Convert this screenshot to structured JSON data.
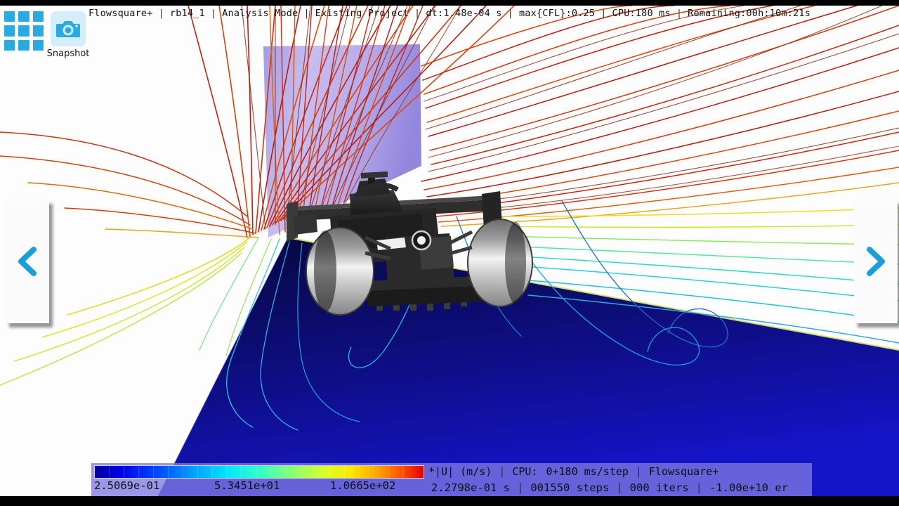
{
  "app": {
    "name": "Flowsquare+",
    "window_title": "Flowsquare+ Analysis Mode"
  },
  "topbar": {
    "segments": [
      "Flowsquare+",
      "rb14_1",
      "Analysis Mode",
      "Existing Project",
      "dt:1.48e-04 s",
      "max{CFL}:0.25",
      "CPU:180 ms",
      "Remaining:00h:10m:21s"
    ],
    "separator": "|"
  },
  "toolbar": {
    "grid_icon_name": "grid-apps-icon",
    "snapshot_label": "Snapshot",
    "snapshot_icon_name": "camera-icon"
  },
  "nav": {
    "prev_label": "<",
    "next_label": ">",
    "prev_icon": "chevron-left-icon",
    "next_icon": "chevron-right-icon"
  },
  "statusbar": {
    "colorbar": {
      "min_label": "2.5069e-01",
      "mid_label": "5.3451e+01",
      "max_label": "1.0665e+02",
      "colormap": "jet",
      "stops": [
        "#0000b0",
        "#0000ff",
        "#0080ff",
        "#00d4ff",
        "#40ffd0",
        "#a0ff60",
        "#ffff00",
        "#ffa000",
        "#ff4000",
        "#d00000"
      ]
    },
    "quantity_label": "*|U|  (m/s)",
    "time_value": "2.2798e-01 s",
    "cpu_label": "CPU:",
    "cpu_value": "0+180  ms/step",
    "steps_value": "001550 steps",
    "iters_value": "000 iters",
    "brand": "Flowsquare+",
    "residual": "-1.00e+10 er",
    "separator": "|"
  },
  "scene": {
    "description": "CFD streamline visualization around an F1 car rear view",
    "background_color": "#ffffff",
    "ground_color": "#0b0b6e",
    "ground_highlight_color": "#d8e86a",
    "inlet_plane_color": "#b4a8e8",
    "car_body_color": "#2b2b2b",
    "tyre_color": "#9a9a9a"
  },
  "chart_data": {
    "type": "heatmap",
    "title": "Velocity magnitude |U| colorbar",
    "colormap": "jet",
    "tick_labels": [
      "2.5069e-01",
      "5.3451e+01",
      "1.0665e+02"
    ],
    "tick_values": [
      0.25069,
      53.451,
      106.65
    ],
    "unit": "m/s",
    "range": [
      0.25069,
      106.65
    ],
    "legend_position": "bottom"
  }
}
